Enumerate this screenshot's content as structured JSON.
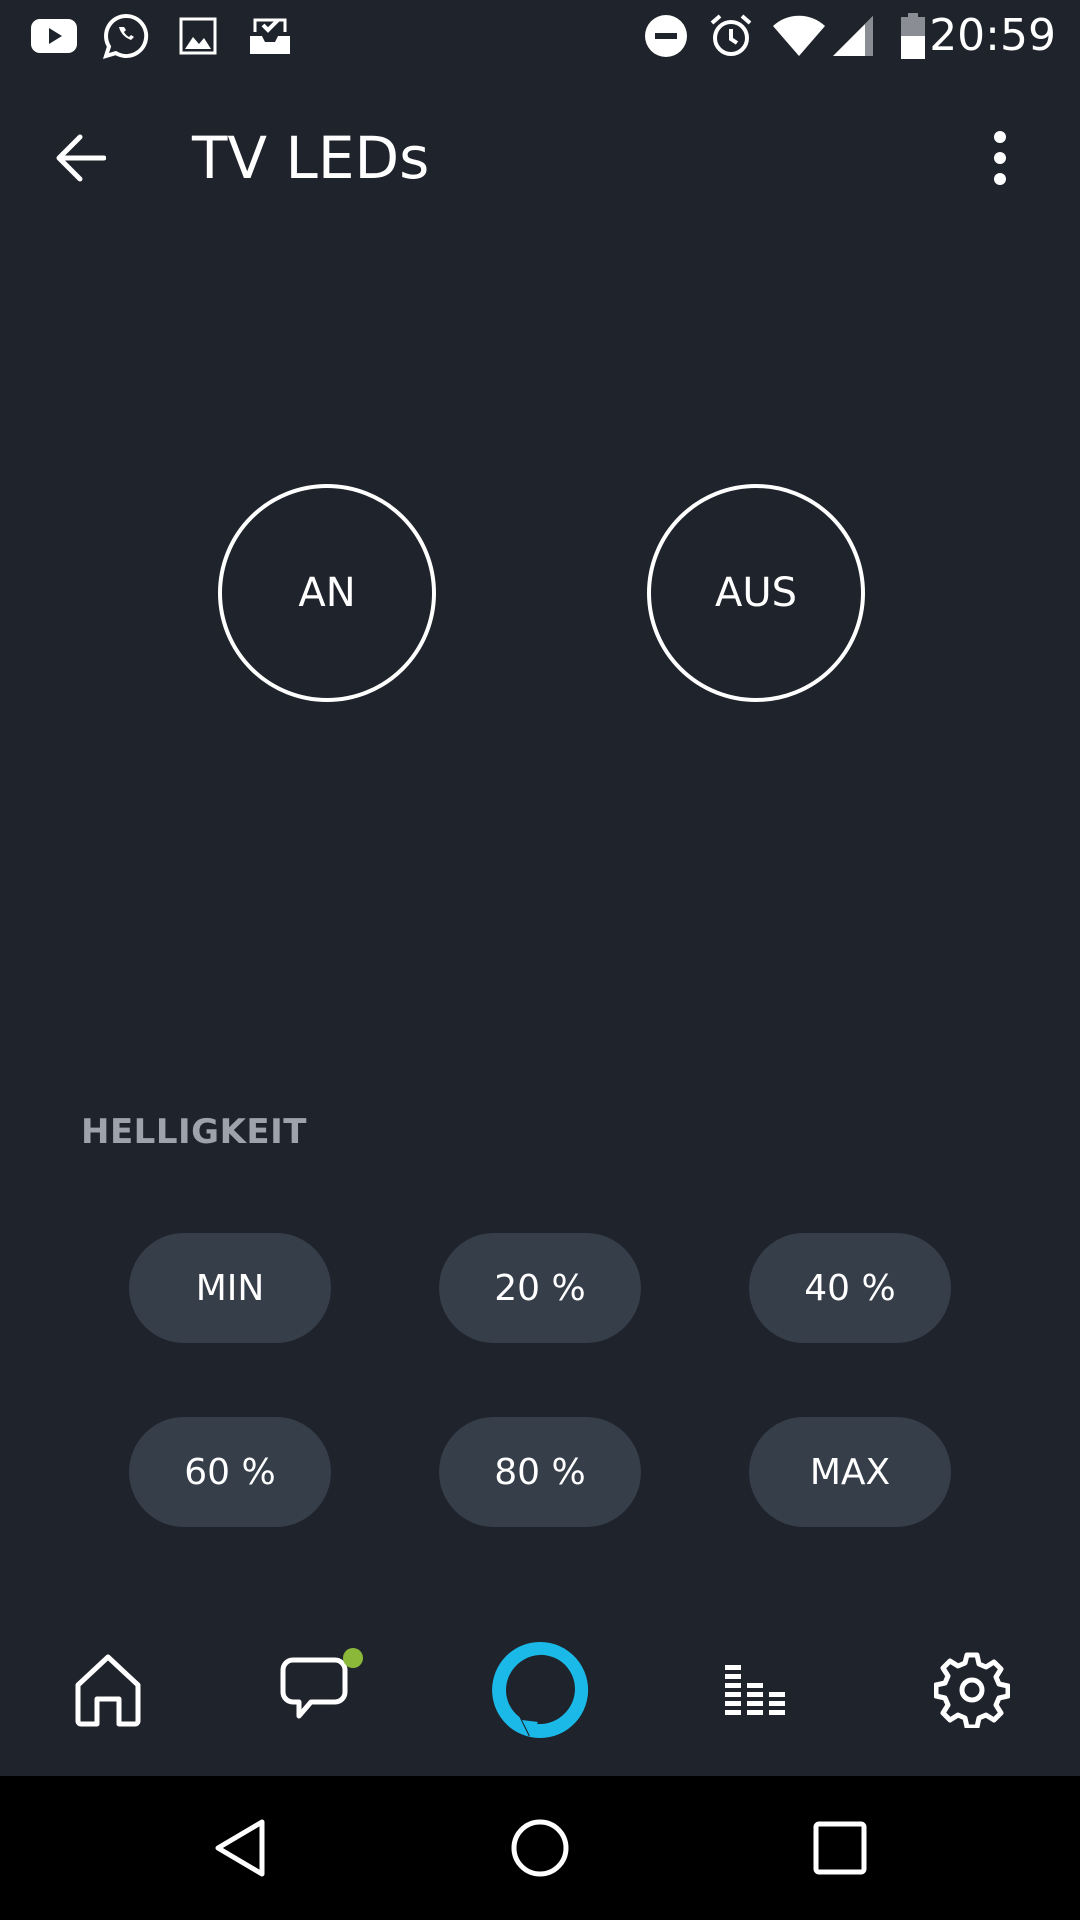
{
  "status_bar": {
    "time": "20:59",
    "left_icons": [
      "youtube-icon",
      "whatsapp-icon",
      "gallery-icon",
      "inbox-check-icon"
    ],
    "right_icons": [
      "do-not-disturb-icon",
      "alarm-icon",
      "wifi-icon",
      "cell-signal-icon",
      "battery-icon"
    ]
  },
  "app_bar": {
    "title": "TV LEDs",
    "back_icon": "arrow-left-icon",
    "menu_icon": "more-vertical-icon"
  },
  "power": {
    "on_label": "AN",
    "off_label": "AUS"
  },
  "brightness": {
    "section_label": "HELLIGKEIT",
    "presets": [
      "MIN",
      "20 %",
      "40 %",
      "60 %",
      "80 %",
      "MAX"
    ]
  },
  "bottom_nav": {
    "items": [
      "home-icon",
      "chat-icon",
      "alexa-icon",
      "music-icon",
      "settings-icon"
    ],
    "chat_notification": true,
    "accent_color": "#1ab9e8",
    "notification_color": "#8cb83a"
  },
  "system_nav": {
    "items": [
      "back-triangle-icon",
      "home-circle-icon",
      "recents-square-icon"
    ]
  },
  "colors": {
    "background": "#1f232b",
    "pill": "#363e4a",
    "section_label": "#9da3ab"
  }
}
